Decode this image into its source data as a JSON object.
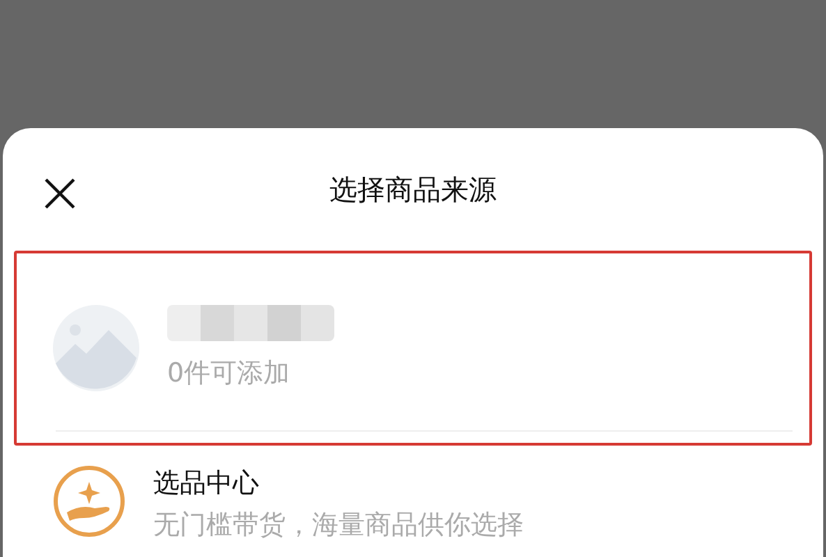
{
  "sheet": {
    "title": "选择商品来源"
  },
  "sources": [
    {
      "kind": "shop",
      "name_redacted": true,
      "subtitle": "0件可添加",
      "highlighted": true
    },
    {
      "kind": "center",
      "title": "选品中心",
      "subtitle": "无门槛带货，海量商品供你选择",
      "highlighted": false
    }
  ]
}
